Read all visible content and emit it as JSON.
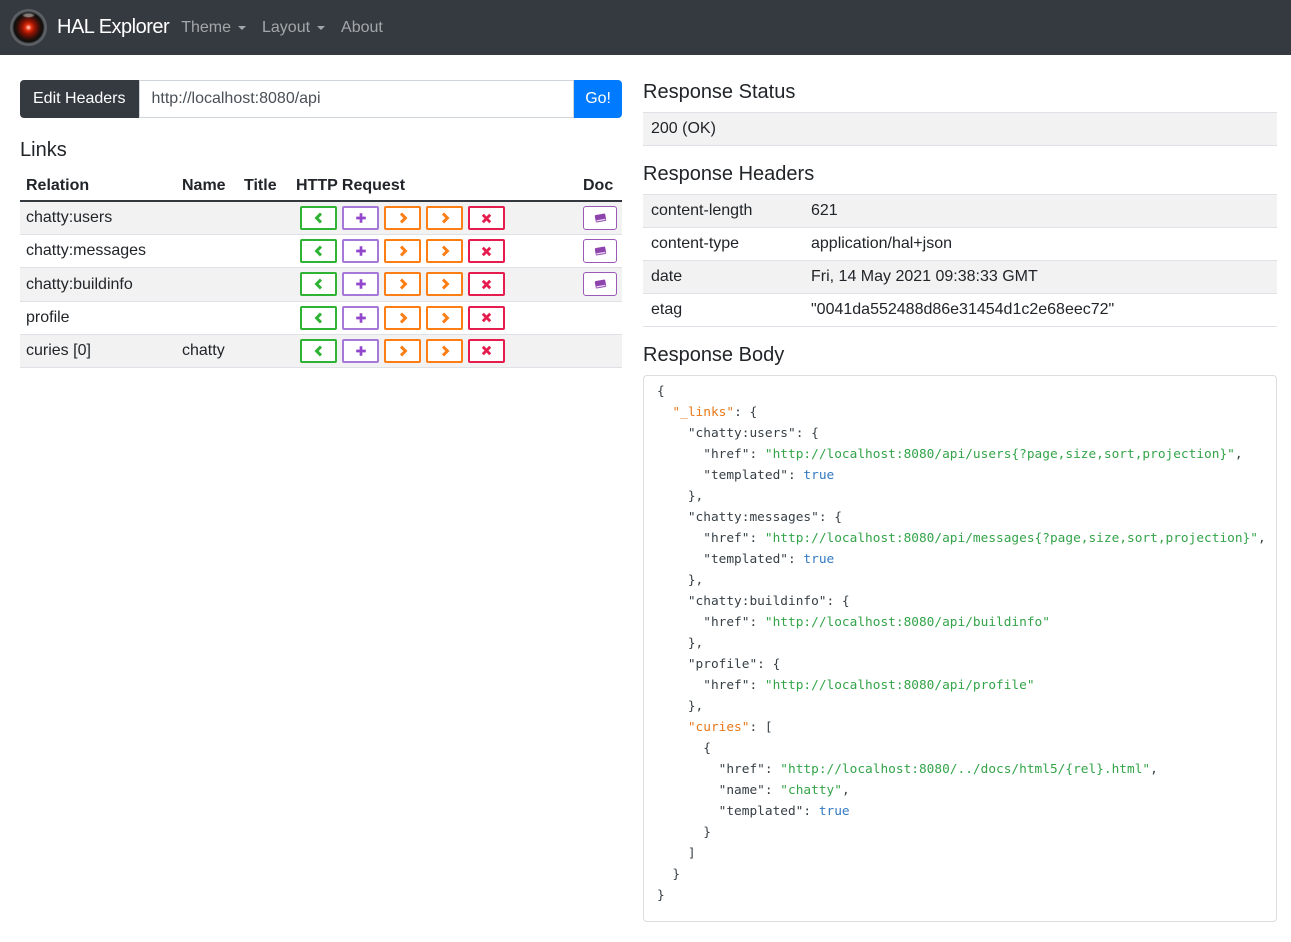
{
  "navbar": {
    "brand": "HAL Explorer",
    "items": [
      {
        "label": "Theme",
        "caret": true
      },
      {
        "label": "Layout",
        "caret": true
      },
      {
        "label": "About",
        "caret": false
      }
    ]
  },
  "request_bar": {
    "edit_headers_label": "Edit Headers",
    "url_value": "http://localhost:8080/api",
    "go_label": "Go!"
  },
  "links_section": {
    "title": "Links",
    "columns": [
      "Relation",
      "Name",
      "Title",
      "HTTP Request",
      "Doc"
    ],
    "rows": [
      {
        "relation": "chatty:users",
        "name": "",
        "title": "",
        "doc": true
      },
      {
        "relation": "chatty:messages",
        "name": "",
        "title": "",
        "doc": true
      },
      {
        "relation": "chatty:buildinfo",
        "name": "",
        "title": "",
        "doc": true
      },
      {
        "relation": "profile",
        "name": "",
        "title": "",
        "doc": false
      },
      {
        "relation": "curies [0]",
        "name": "chatty",
        "title": "",
        "doc": false
      }
    ],
    "request_buttons": [
      "get",
      "post",
      "put",
      "patch",
      "delete"
    ]
  },
  "response_status": {
    "title": "Response Status",
    "value": "200 (OK)"
  },
  "response_headers": {
    "title": "Response Headers",
    "rows": [
      {
        "key": "content-length",
        "value": "621"
      },
      {
        "key": "content-type",
        "value": "application/hal+json"
      },
      {
        "key": "date",
        "value": "Fri, 14 May 2021 09:38:33 GMT"
      },
      {
        "key": "etag",
        "value": "\"0041da552488d86e31454d1c2e68eec72\""
      }
    ]
  },
  "response_body": {
    "title": "Response Body",
    "json": {
      "_links": {
        "chatty:users": {
          "href": "http://localhost:8080/api/users{?page,size,sort,projection}",
          "templated": true
        },
        "chatty:messages": {
          "href": "http://localhost:8080/api/messages{?page,size,sort,projection}",
          "templated": true
        },
        "chatty:buildinfo": {
          "href": "http://localhost:8080/api/buildinfo"
        },
        "profile": {
          "href": "http://localhost:8080/api/profile"
        },
        "curies": [
          {
            "href": "http://localhost:8080/../docs/html5/{rel}.html",
            "name": "chatty",
            "templated": true
          }
        ]
      }
    }
  }
}
